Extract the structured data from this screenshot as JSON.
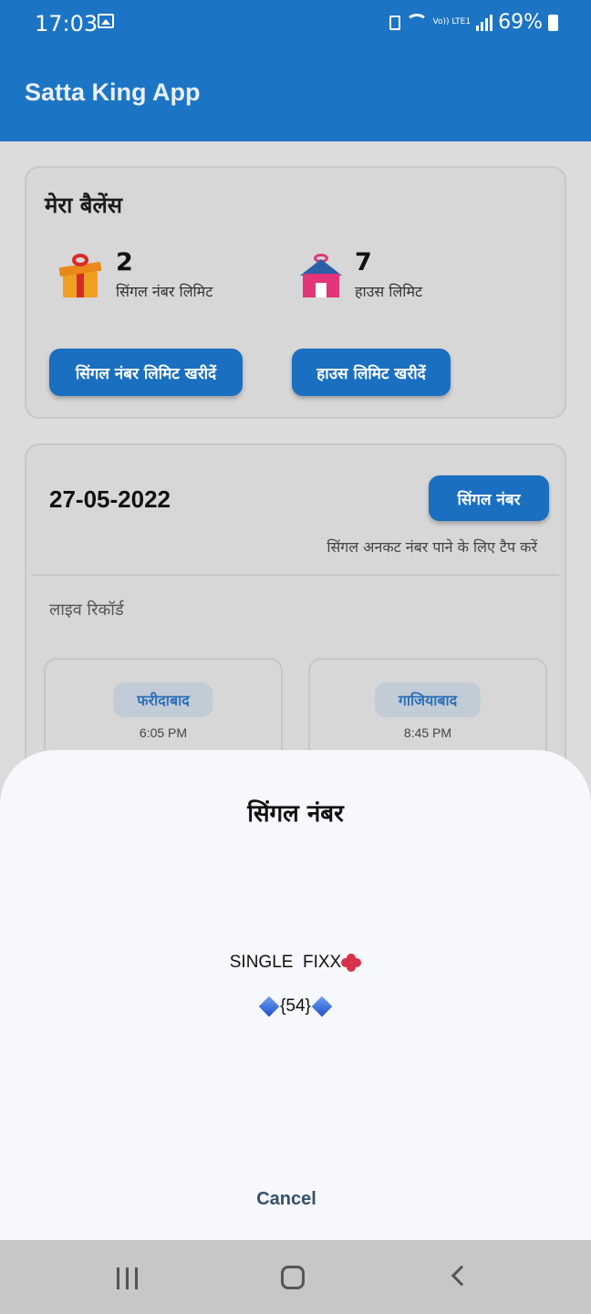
{
  "status_bar": {
    "time": "17:03",
    "network": "Vo)) LTE1",
    "battery": "69%",
    "icons": [
      "gallery-icon",
      "lock-icon",
      "wifi-icon",
      "signal-icon",
      "battery-icon"
    ]
  },
  "app_bar": {
    "title": "Satta King App"
  },
  "balance": {
    "title": "मेरा बैलेंस",
    "single_limit": {
      "value": "2",
      "label": "सिंगल नंबर लिमिट",
      "icon": "gift-icon"
    },
    "house_limit": {
      "value": "7",
      "label": "हाउस लिमिट",
      "icon": "house-gift-icon"
    },
    "buy_single_label": "सिंगल नंबर लिमिट खरीदें",
    "buy_house_label": "हाउस लिमिट खरीदें"
  },
  "records": {
    "date": "27-05-2022",
    "single_button_label": "सिंगल नंबर",
    "tap_hint": "सिंगल अनकट नंबर पाने के लिए टैप करें",
    "live_label": "लाइव रिकॉर्ड",
    "games": [
      {
        "name": "फरीदाबाद",
        "time": "6:05 PM"
      },
      {
        "name": "गाजियाबाद",
        "time": "8:45 PM"
      }
    ]
  },
  "sheet": {
    "title": "सिंगल नंबर",
    "line1": "SINGLE  FIXX",
    "line2": "{54}",
    "cancel_label": "Cancel"
  },
  "colors": {
    "primary": "#1c74c4",
    "button": "#1a6fc0",
    "chip": "#2b6fb8"
  }
}
